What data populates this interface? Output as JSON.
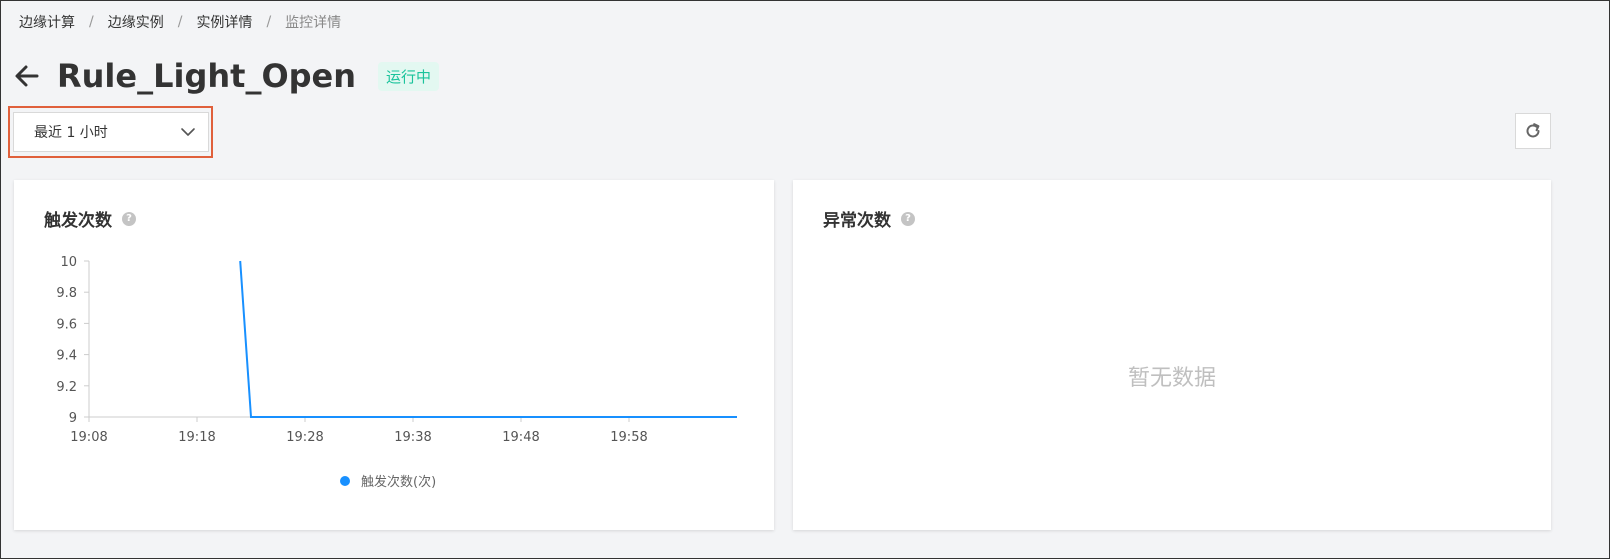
{
  "breadcrumb": [
    {
      "label": "边缘计算"
    },
    {
      "label": "边缘实例"
    },
    {
      "label": "实例详情"
    },
    {
      "label": "监控详情"
    }
  ],
  "breadcrumb_separator": "/",
  "page": {
    "title": "Rule_Light_Open",
    "status": "运行中",
    "status_color": "#1ac39b"
  },
  "toolbar": {
    "time_range": "最近 1 小时",
    "refresh_icon": "refresh-icon"
  },
  "cards": {
    "trigger": {
      "title": "触发次数",
      "help": "?"
    },
    "error": {
      "title": "异常次数",
      "help": "?",
      "empty_text": "暂无数据"
    }
  },
  "chart_data": {
    "type": "line",
    "x_ticks": [
      "19:08",
      "19:18",
      "19:28",
      "19:38",
      "19:48",
      "19:58"
    ],
    "xlim": [
      "19:08",
      "20:08"
    ],
    "ylim": [
      9,
      10
    ],
    "y_ticks": [
      "10",
      "9.8",
      "9.6",
      "9.4",
      "9.2",
      "9"
    ],
    "series": [
      {
        "name": "触发次数(次)",
        "color": "#1890ff",
        "points": [
          {
            "x": "19:22",
            "y": 10
          },
          {
            "x": "19:23",
            "y": 9
          },
          {
            "x": "20:08",
            "y": 9
          }
        ]
      }
    ],
    "legend": "bottom-center",
    "grid": false
  }
}
